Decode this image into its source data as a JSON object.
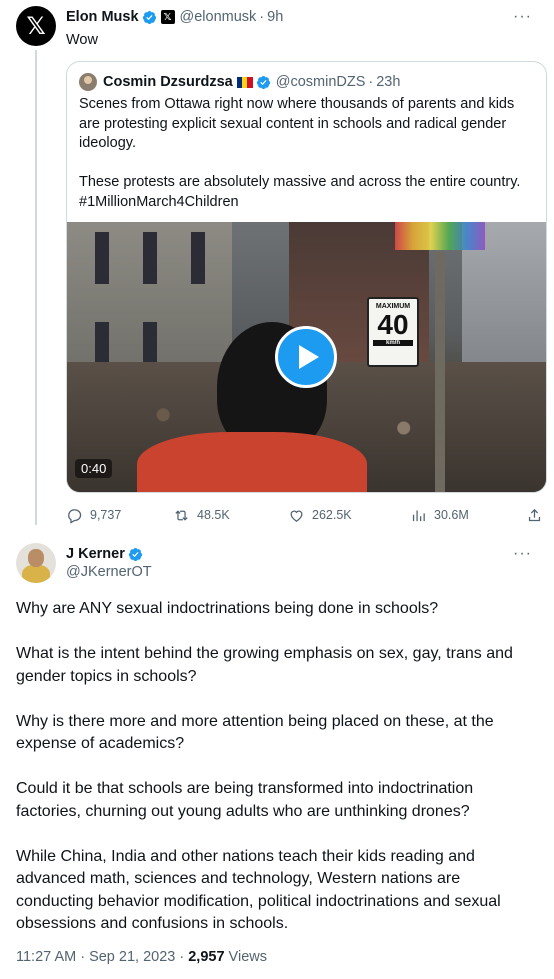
{
  "tweet": {
    "author_name": "Elon Musk",
    "handle": "@elonmusk",
    "separator": "·",
    "time": "9h",
    "text": "Wow",
    "more": "···",
    "brand_badge": "𝕏"
  },
  "quoted": {
    "author_name": "Cosmin Dzsurdzsa",
    "handle": "@cosminDZS",
    "separator": "·",
    "time": "23h",
    "paragraph1": "Scenes from Ottawa right now where thousands of parents and kids are protesting explicit sexual content in schools and radical gender ideology.",
    "paragraph2": "These protests are absolutely massive and across the entire country. #1MillionMarch4Children",
    "video_duration": "0:40",
    "sign_top": "MAXIMUM",
    "sign_number": "40",
    "sign_unit": "km/h",
    "flag_colors": [
      "#002b7f",
      "#fcd116",
      "#ce1126"
    ]
  },
  "actions": {
    "replies": "9,737",
    "reposts": "48.5K",
    "likes": "262.5K",
    "views": "30.6M"
  },
  "reply": {
    "author_name": "J Kerner",
    "handle": "@JKernerOT",
    "more": "···",
    "paragraphs": [
      "Why are ANY sexual indoctrinations being done in schools?",
      "What is the intent behind the growing emphasis on sex, gay, trans and gender topics in schools?",
      "Why is there more and more attention being placed on these, at the expense of academics?",
      "Could it be that schools are being transformed into indoctrination factories, churning out young adults who are unthinking drones?",
      "While China, India and other nations teach their kids reading and advanced math, sciences and technology, Western nations are conducting behavior modification, political indoctrinations and sexual obsessions and confusions in schools."
    ],
    "timestamp": "11:27 AM · Sep 21, 2023 · ",
    "views_count": "2,957",
    "views_label": " Views"
  },
  "colors": {
    "verified_blue": "#1d9bf0",
    "text_primary": "#0f1419",
    "text_secondary": "#536471",
    "border": "#cfd9de"
  },
  "icons": [
    "x-logo-icon",
    "verified-badge-icon",
    "x-badge-icon",
    "more-icon",
    "play-icon",
    "reply-icon",
    "repost-icon",
    "like-icon",
    "views-icon",
    "share-icon"
  ]
}
